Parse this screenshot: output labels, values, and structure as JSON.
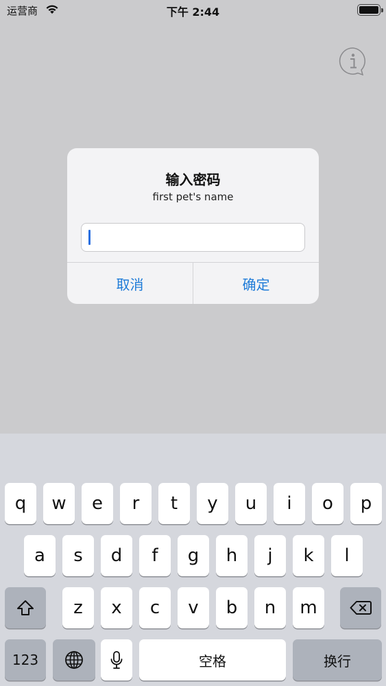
{
  "status_bar": {
    "carrier": "运营商",
    "time": "下午 2:44"
  },
  "info_button": {
    "icon": "info-icon"
  },
  "alert": {
    "title": "输入密码",
    "message": "first pet's name",
    "input_value": "",
    "cancel_label": "取消",
    "confirm_label": "确定",
    "accent_color": "#1e7bd8"
  },
  "keyboard": {
    "row1": [
      "q",
      "w",
      "e",
      "r",
      "t",
      "y",
      "u",
      "i",
      "o",
      "p"
    ],
    "row2": [
      "a",
      "s",
      "d",
      "f",
      "g",
      "h",
      "j",
      "k",
      "l"
    ],
    "row3": [
      "z",
      "x",
      "c",
      "v",
      "b",
      "n",
      "m"
    ],
    "shift_icon": "shift-icon",
    "delete_icon": "delete-icon",
    "numbers_label": "123",
    "globe_icon": "globe-icon",
    "mic_icon": "microphone-icon",
    "space_label": "空格",
    "return_label": "换行"
  }
}
